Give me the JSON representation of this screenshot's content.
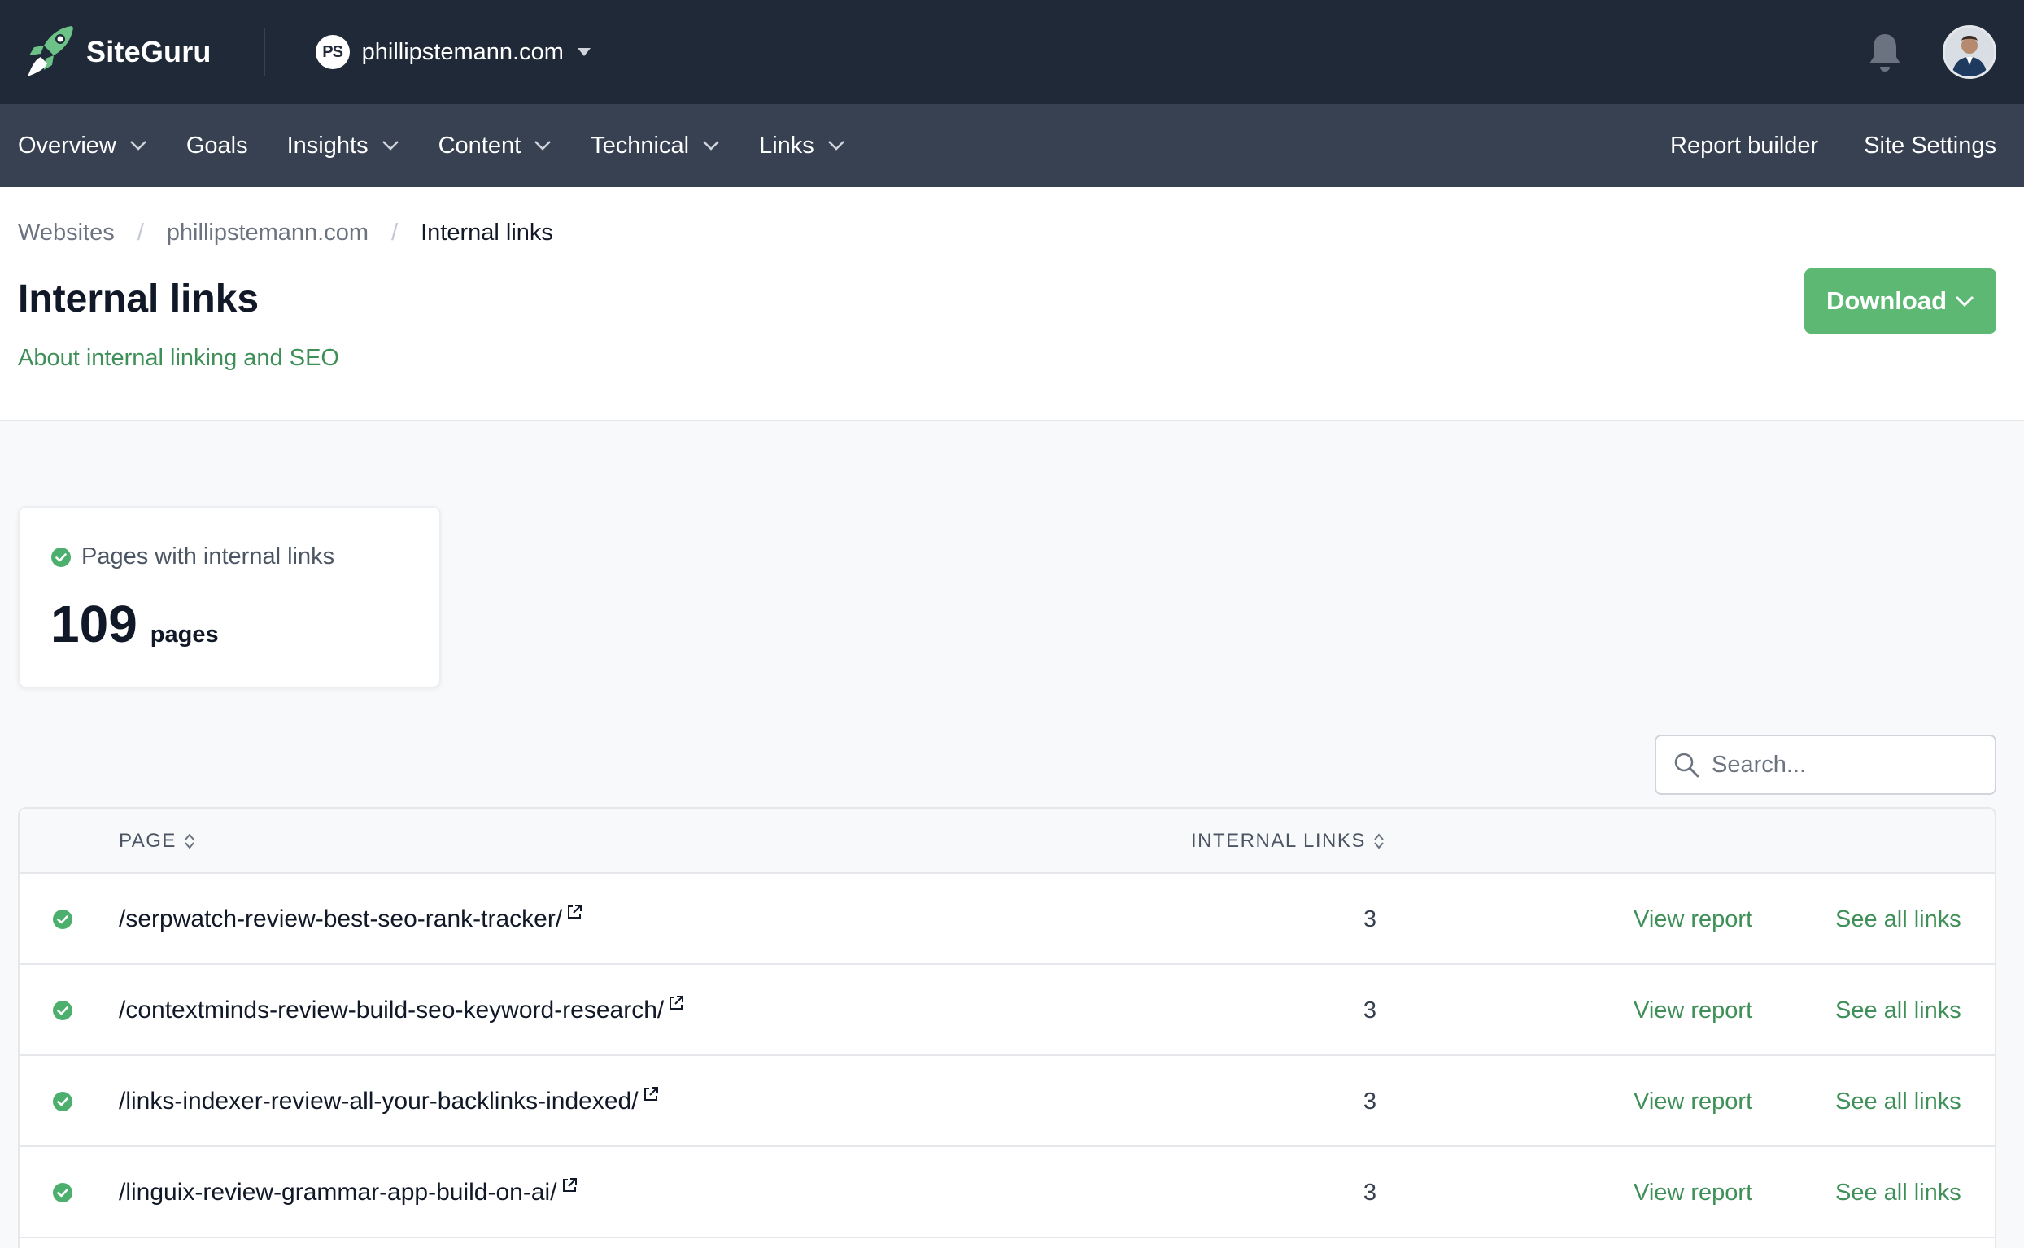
{
  "brand": {
    "name": "SiteGuru",
    "icon": "rocket-icon"
  },
  "site": {
    "avatar_initials": "PS",
    "name": "phillipstemann.com"
  },
  "nav": {
    "left": [
      {
        "label": "Overview",
        "dropdown": true
      },
      {
        "label": "Goals",
        "dropdown": false
      },
      {
        "label": "Insights",
        "dropdown": true
      },
      {
        "label": "Content",
        "dropdown": true
      },
      {
        "label": "Technical",
        "dropdown": true
      },
      {
        "label": "Links",
        "dropdown": true
      }
    ],
    "right": [
      {
        "label": "Report builder"
      },
      {
        "label": "Site Settings"
      }
    ]
  },
  "breadcrumb": {
    "items": [
      "Websites",
      "phillipstemann.com"
    ],
    "separator": "/",
    "current": "Internal links"
  },
  "page": {
    "title": "Internal links",
    "about_link": "About internal linking and SEO",
    "download_label": "Download"
  },
  "stat": {
    "label": "Pages with internal links",
    "value": "109",
    "unit": "pages"
  },
  "search": {
    "placeholder": "Search..."
  },
  "table": {
    "columns": {
      "page": "PAGE",
      "internal_links": "INTERNAL LINKS"
    },
    "rows": [
      {
        "page": "/serpwatch-review-best-seo-rank-tracker/",
        "links": "3",
        "view": "View report",
        "see": "See all links"
      },
      {
        "page": "/contextminds-review-build-seo-keyword-research/",
        "links": "3",
        "view": "View report",
        "see": "See all links"
      },
      {
        "page": "/links-indexer-review-all-your-backlinks-indexed/",
        "links": "3",
        "view": "View report",
        "see": "See all links"
      },
      {
        "page": "/linguix-review-grammar-app-build-on-ai/",
        "links": "3",
        "view": "View report",
        "see": "See all links"
      }
    ]
  },
  "colors": {
    "topbar": "#1f2937",
    "navbar": "#374151",
    "accent_green": "#5cb872",
    "link_green": "#3f8f58"
  }
}
